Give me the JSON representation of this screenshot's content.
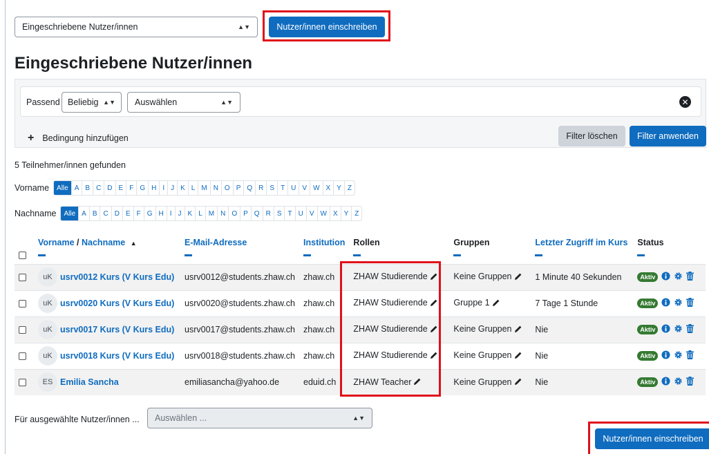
{
  "header": {
    "view_select": "Eingeschriebene Nutzer/innen",
    "enrol_button_top": "Nutzer/innen einschreiben",
    "page_title": "Eingeschriebene Nutzer/innen"
  },
  "filter": {
    "match_label": "Passend",
    "match_value": "Beliebig",
    "condition_select": "Auswählen",
    "add_condition": "Bedingung hinzufügen",
    "clear_button": "Filter löschen",
    "apply_button": "Filter anwenden"
  },
  "results_count": "5 Teilnehmer/innen gefunden",
  "initials": {
    "firstname_label": "Vorname",
    "lastname_label": "Nachname",
    "all_label": "Alle",
    "letters": [
      "A",
      "B",
      "C",
      "D",
      "E",
      "F",
      "G",
      "H",
      "I",
      "J",
      "K",
      "L",
      "M",
      "N",
      "O",
      "P",
      "Q",
      "R",
      "S",
      "T",
      "U",
      "V",
      "W",
      "X",
      "Y",
      "Z"
    ]
  },
  "table": {
    "headers": {
      "firstname": "Vorname",
      "separator": " / ",
      "lastname": "Nachname",
      "sort_arrow": "▲",
      "email": "E-Mail-Adresse",
      "institution": "Institution",
      "roles": "Rollen",
      "groups": "Gruppen",
      "last_access": "Letzter Zugriff im Kurs",
      "status": "Status"
    },
    "rows": [
      {
        "initials": "uK",
        "name": "usrv0012 Kurs (V Kurs Edu)",
        "email": "usrv0012@students.zhaw.ch",
        "institution": "zhaw.ch",
        "role": "ZHAW Studierende",
        "group": "Keine Gruppen",
        "last_access": "1 Minute 40 Sekunden",
        "status": "Aktiv"
      },
      {
        "initials": "uK",
        "name": "usrv0020 Kurs (V Kurs Edu)",
        "email": "usrv0020@students.zhaw.ch",
        "institution": "zhaw.ch",
        "role": "ZHAW Studierende",
        "group": "Gruppe 1",
        "last_access": "7 Tage 1 Stunde",
        "status": "Aktiv"
      },
      {
        "initials": "uK",
        "name": "usrv0017 Kurs (V Kurs Edu)",
        "email": "usrv0017@students.zhaw.ch",
        "institution": "zhaw.ch",
        "role": "ZHAW Studierende",
        "group": "Keine Gruppen",
        "last_access": "Nie",
        "status": "Aktiv"
      },
      {
        "initials": "uK",
        "name": "usrv0018 Kurs (V Kurs Edu)",
        "email": "usrv0018@students.zhaw.ch",
        "institution": "zhaw.ch",
        "role": "ZHAW Studierende",
        "group": "Keine Gruppen",
        "last_access": "Nie",
        "status": "Aktiv"
      },
      {
        "initials": "ES",
        "name": "Emilia Sancha",
        "email": "emiliasancha@yahoo.de",
        "institution": "eduid.ch",
        "role": "ZHAW Teacher",
        "group": "Keine Gruppen",
        "last_access": "Nie",
        "status": "Aktiv"
      }
    ]
  },
  "bulk": {
    "label": "Für ausgewählte Nutzer/innen ...",
    "select": "Auswählen ..."
  },
  "footer": {
    "enrol_button_bottom": "Nutzer/innen einschreiben"
  },
  "colors": {
    "primary": "#0f6cbf",
    "highlight": "#e0101a",
    "active_badge": "#357a32"
  }
}
